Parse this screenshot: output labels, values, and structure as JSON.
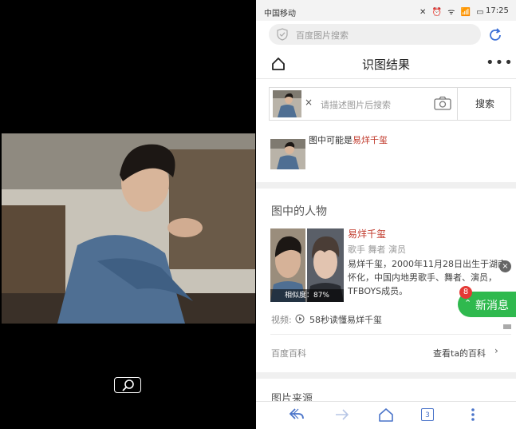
{
  "status_bar": {
    "carrier": "中国移动",
    "icons": "✕ ⏰ ᯤ 📶 ▭",
    "time": "17:25"
  },
  "browser": {
    "url_placeholder": "百度图片搜索"
  },
  "header": {
    "title": "识图结果",
    "more": "•••"
  },
  "search": {
    "clear": "×",
    "placeholder": "请描述图片后搜索",
    "button_label": "搜索"
  },
  "guess": {
    "prefix": "图中可能是",
    "name": "易烊千玺"
  },
  "person_section": {
    "title": "图中的人物",
    "name": "易烊千玺",
    "tags": "歌手  舞者  演员",
    "description": "易烊千玺，2000年11月28日出生于湖南怀化，中国内地男歌手、舞者、演员，TFBOYS成员。",
    "similarity": "相似度：87%",
    "video_label": "视频:",
    "video_title": "58秒读懂易烊千玺",
    "baike_source": "百度百科",
    "baike_link": "查看ta的百科"
  },
  "news": {
    "label": "新消息",
    "count": "8"
  },
  "next_section": {
    "title": "图片来源"
  },
  "nav": {
    "tabs_count": "3"
  },
  "colors": {
    "accent_blue": "#4a74c9",
    "name_red": "#c0392b",
    "news_green": "#2fb94e"
  }
}
